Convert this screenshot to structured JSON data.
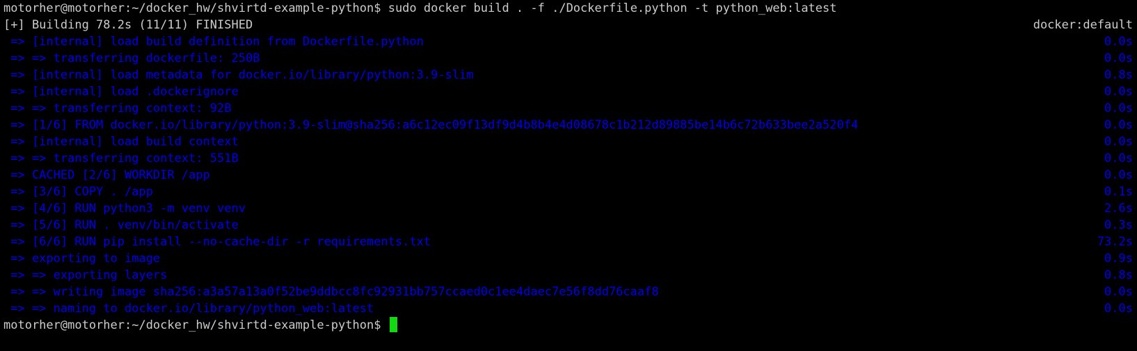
{
  "colors": {
    "background": "#000000",
    "text": "#cccccc",
    "build_steps": "#0000ee",
    "cursor": "#13d913"
  },
  "command_line": {
    "prompt": "motorher@motorher:~/docker_hw/shvirtd-example-python$",
    "command": "sudo docker build . -f ./Dockerfile.python -t python_web:latest"
  },
  "build_status": {
    "text": "[+] Building 78.2s (11/11) FINISHED",
    "builder": "docker:default"
  },
  "steps": [
    {
      "text": " => [internal] load build definition from Dockerfile.python",
      "time": "0.0s"
    },
    {
      "text": " => => transferring dockerfile: 250B",
      "time": "0.0s"
    },
    {
      "text": " => [internal] load metadata for docker.io/library/python:3.9-slim",
      "time": "0.8s"
    },
    {
      "text": " => [internal] load .dockerignore",
      "time": "0.0s"
    },
    {
      "text": " => => transferring context: 92B",
      "time": "0.0s"
    },
    {
      "text": " => [1/6] FROM docker.io/library/python:3.9-slim@sha256:a6c12ec09f13df9d4b8b4e4d08678c1b212d89885be14b6c72b633bee2a520f4",
      "time": "0.0s"
    },
    {
      "text": " => [internal] load build context",
      "time": "0.0s"
    },
    {
      "text": " => => transferring context: 551B",
      "time": "0.0s"
    },
    {
      "text": " => CACHED [2/6] WORKDIR /app",
      "time": "0.0s"
    },
    {
      "text": " => [3/6] COPY . /app",
      "time": "0.1s"
    },
    {
      "text": " => [4/6] RUN python3 -m venv venv",
      "time": "2.6s"
    },
    {
      "text": " => [5/6] RUN . venv/bin/activate",
      "time": "0.3s"
    },
    {
      "text": " => [6/6] RUN pip install --no-cache-dir -r requirements.txt",
      "time": "73.2s"
    },
    {
      "text": " => exporting to image",
      "time": "0.9s"
    },
    {
      "text": " => => exporting layers",
      "time": "0.8s"
    },
    {
      "text": " => => writing image sha256:a3a57a13a0f52be9ddbcc8fc92931bb757ccaed0c1ee4daec7e56f8dd76caaf8",
      "time": "0.0s"
    },
    {
      "text": " => => naming to docker.io/library/python_web:latest",
      "time": "0.0s"
    }
  ],
  "final_prompt": {
    "prompt": "motorher@motorher:~/docker_hw/shvirtd-example-python$"
  }
}
